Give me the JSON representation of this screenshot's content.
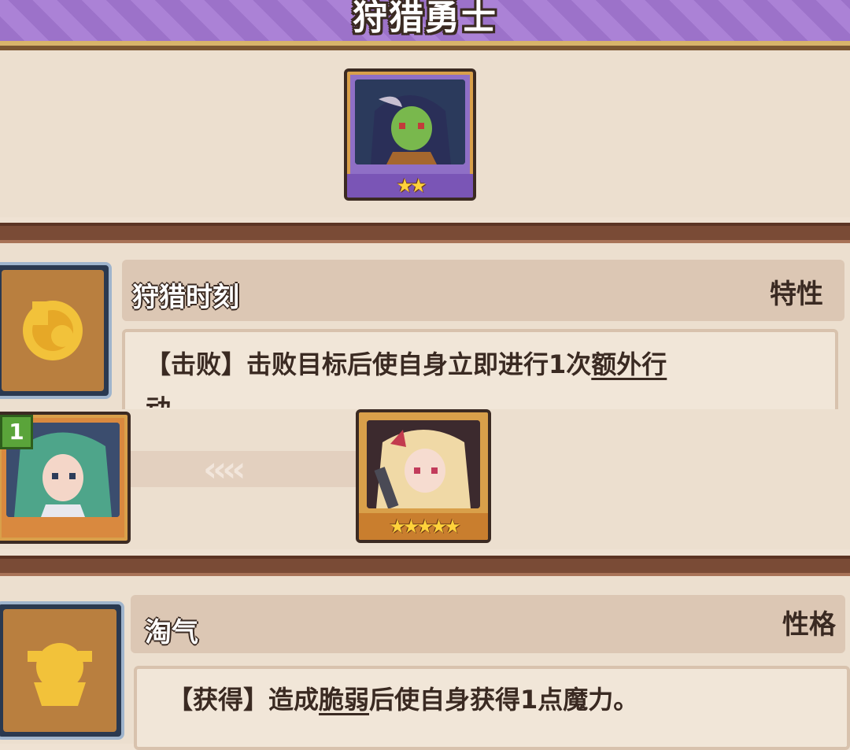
{
  "banner": {
    "title": "狩猎勇士"
  },
  "top_unit": {
    "stars": "★★",
    "star_count": 2,
    "name_icon": "green-skin-girl-portrait"
  },
  "trait": {
    "name": "狩猎时刻",
    "type": "特性",
    "desc_prefix": "【击败】击败目标后使自身立即进行1次",
    "desc_link": "额外行",
    "desc_cut": "动"
  },
  "swap": {
    "left_badge": "1",
    "left_icon": "teal-hair-girl-portrait",
    "arrows": "‹‹‹‹",
    "right_stars": "★★★★★",
    "right_star_count": 5,
    "right_icon": "blonde-horn-girl-portrait"
  },
  "personality": {
    "name": "淘气",
    "type": "性格",
    "desc_prefix": "【获得】造成",
    "desc_link": "脆弱",
    "desc_suffix": "后使自身获得1点魔力。"
  },
  "colors": {
    "banner_purple": "#9c72c9",
    "frame_gold": "#d9a04a",
    "divider_brown": "#7a4b36",
    "panel_beige": "#ecdfcf"
  }
}
